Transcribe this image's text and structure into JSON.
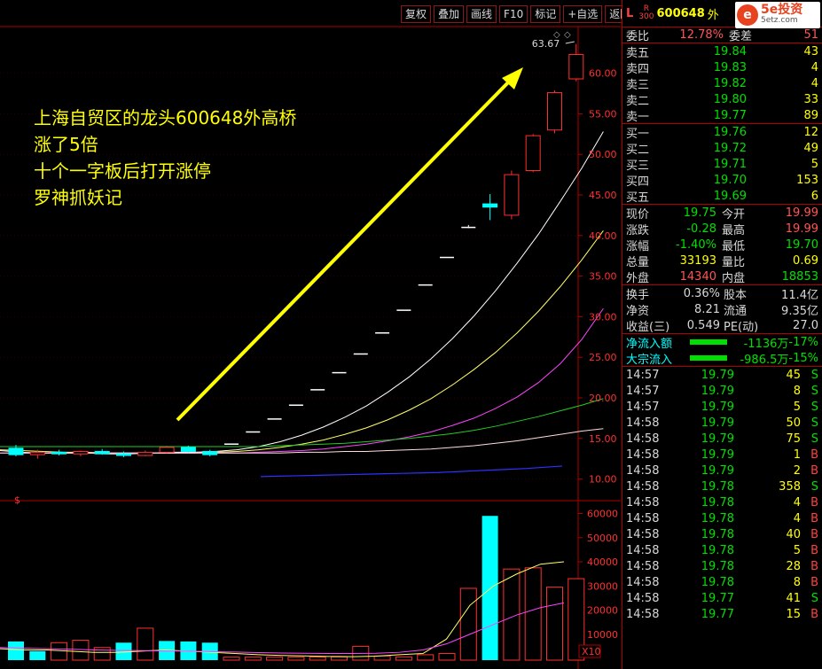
{
  "toolbar": [
    {
      "label": "复权",
      "name": "fuquan-button"
    },
    {
      "label": "叠加",
      "name": "diejia-button"
    },
    {
      "label": "画线",
      "name": "draw-line-button"
    },
    {
      "label": "F10",
      "name": "f10-button"
    },
    {
      "label": "标记",
      "name": "mark-button"
    },
    {
      "label": "+自选",
      "name": "add-watchlist-button"
    },
    {
      "label": "返回",
      "name": "back-button"
    }
  ],
  "quote": {
    "header": {
      "l": "L",
      "r": "R",
      "r_sub": "300",
      "code": "600648",
      "name": "外"
    },
    "logo": {
      "icon": "e",
      "title": "5e投资",
      "sub": "5etz.com"
    },
    "weibi": {
      "label": "委比",
      "value": "12.78%",
      "label2": "委差",
      "value2": "51"
    },
    "asks": [
      {
        "label": "卖五",
        "price": "19.84",
        "vol": "43"
      },
      {
        "label": "卖四",
        "price": "19.83",
        "vol": "4"
      },
      {
        "label": "卖三",
        "price": "19.82",
        "vol": "4"
      },
      {
        "label": "卖二",
        "price": "19.80",
        "vol": "33"
      },
      {
        "label": "卖一",
        "price": "19.77",
        "vol": "89"
      }
    ],
    "bids": [
      {
        "label": "买一",
        "price": "19.76",
        "vol": "12"
      },
      {
        "label": "买二",
        "price": "19.72",
        "vol": "49"
      },
      {
        "label": "买三",
        "price": "19.71",
        "vol": "5"
      },
      {
        "label": "买四",
        "price": "19.70",
        "vol": "153"
      },
      {
        "label": "买五",
        "price": "19.69",
        "vol": "6"
      }
    ],
    "stats1": [
      {
        "l1": "现价",
        "v1": "19.75",
        "c1": "g",
        "l2": "今开",
        "v2": "19.99",
        "c2": "r"
      },
      {
        "l1": "涨跌",
        "v1": "-0.28",
        "c1": "g",
        "l2": "最高",
        "v2": "19.99",
        "c2": "r"
      },
      {
        "l1": "涨幅",
        "v1": "-1.40%",
        "c1": "g",
        "l2": "最低",
        "v2": "19.70",
        "c2": "g"
      },
      {
        "l1": "总量",
        "v1": "33193",
        "c1": "y",
        "l2": "量比",
        "v2": "0.69",
        "c2": "y"
      },
      {
        "l1": "外盘",
        "v1": "14340",
        "c1": "r",
        "l2": "内盘",
        "v2": "18853",
        "c2": "g"
      }
    ],
    "stats2": [
      {
        "l1": "换手",
        "v1": "0.36%",
        "l2": "股本",
        "v2": "11.4亿"
      },
      {
        "l1": "净资",
        "v1": "8.21",
        "l2": "流通",
        "v2": "9.35亿"
      },
      {
        "l1": "收益(三)",
        "v1": "0.549",
        "l2": "PE(动)",
        "v2": "27.0"
      }
    ],
    "flows": [
      {
        "label": "净流入额",
        "value": "-1136万",
        "pct": "-17%"
      },
      {
        "label": "大宗流入",
        "value": "-986.5万",
        "pct": "-15%"
      }
    ],
    "ticks": [
      {
        "t": "14:57",
        "p": "19.79",
        "v": "45",
        "s": "S"
      },
      {
        "t": "14:57",
        "p": "19.79",
        "v": "8",
        "s": "S"
      },
      {
        "t": "14:57",
        "p": "19.79",
        "v": "5",
        "s": "S"
      },
      {
        "t": "14:58",
        "p": "19.79",
        "v": "50",
        "s": "S"
      },
      {
        "t": "14:58",
        "p": "19.79",
        "v": "75",
        "s": "S"
      },
      {
        "t": "14:58",
        "p": "19.79",
        "v": "1",
        "s": "B"
      },
      {
        "t": "14:58",
        "p": "19.79",
        "v": "2",
        "s": "B"
      },
      {
        "t": "14:58",
        "p": "19.78",
        "v": "358",
        "s": "S"
      },
      {
        "t": "14:58",
        "p": "19.78",
        "v": "4",
        "s": "B"
      },
      {
        "t": "14:58",
        "p": "19.78",
        "v": "4",
        "s": "B"
      },
      {
        "t": "14:58",
        "p": "19.78",
        "v": "40",
        "s": "B"
      },
      {
        "t": "14:58",
        "p": "19.78",
        "v": "5",
        "s": "B"
      },
      {
        "t": "14:58",
        "p": "19.78",
        "v": "28",
        "s": "B"
      },
      {
        "t": "14:58",
        "p": "19.78",
        "v": "8",
        "s": "B"
      },
      {
        "t": "14:58",
        "p": "19.77",
        "v": "41",
        "s": "S"
      },
      {
        "t": "14:58",
        "p": "19.77",
        "v": "15",
        "s": "B"
      }
    ]
  },
  "annotation": [
    "上海自贸区的龙头600648外高桥",
    "涨了5倍",
    "十个一字板后打开涨停",
    "罗神抓妖记"
  ],
  "colors": {
    "up": "#ff3030",
    "down": "#00ffff",
    "flat": "#ffffff",
    "grid": "#b00000",
    "arrow": "#ffff00"
  },
  "chart_data": {
    "type": "candlestick",
    "price_axis": {
      "ticks": [
        10,
        15,
        20,
        25,
        30,
        35,
        40,
        45,
        50,
        55,
        60
      ],
      "labels": [
        "10.00",
        "15.00",
        "20.00",
        "25.00",
        "30.00",
        "35.00",
        "40.00",
        "45.00",
        "50.00",
        "55.00",
        "60.00"
      ],
      "ylim": [
        7,
        67
      ]
    },
    "max_label": "63.67",
    "volume_axis": {
      "ticks": [
        10000,
        20000,
        30000,
        40000,
        50000,
        60000
      ],
      "labels": [
        "10000",
        "20000",
        "30000",
        "40000",
        "50000",
        "60000"
      ],
      "unit": "X10",
      "ylim": [
        0,
        62000
      ]
    },
    "candles": [
      {
        "o": 13.8,
        "h": 14.2,
        "l": 12.8,
        "c": 13.0
      },
      {
        "o": 13.0,
        "h": 13.6,
        "l": 12.5,
        "c": 13.3
      },
      {
        "o": 13.3,
        "h": 13.6,
        "l": 12.9,
        "c": 13.1
      },
      {
        "o": 13.1,
        "h": 13.5,
        "l": 12.8,
        "c": 13.4
      },
      {
        "o": 13.4,
        "h": 13.7,
        "l": 13.0,
        "c": 13.1
      },
      {
        "o": 13.1,
        "h": 13.4,
        "l": 12.7,
        "c": 12.9
      },
      {
        "o": 12.9,
        "h": 13.5,
        "l": 12.8,
        "c": 13.3
      },
      {
        "o": 13.3,
        "h": 14.1,
        "l": 13.2,
        "c": 13.9
      },
      {
        "o": 13.9,
        "h": 14.1,
        "l": 13.3,
        "c": 13.4
      },
      {
        "o": 13.4,
        "h": 13.6,
        "l": 12.8,
        "c": 13.0
      },
      {
        "o": 14.3,
        "h": 14.3,
        "l": 14.3,
        "c": 14.3
      },
      {
        "o": 15.8,
        "h": 15.8,
        "l": 15.8,
        "c": 15.8
      },
      {
        "o": 17.4,
        "h": 17.4,
        "l": 17.4,
        "c": 17.4
      },
      {
        "o": 19.1,
        "h": 19.1,
        "l": 19.1,
        "c": 19.1
      },
      {
        "o": 21.0,
        "h": 21.0,
        "l": 21.0,
        "c": 21.0
      },
      {
        "o": 23.1,
        "h": 23.1,
        "l": 23.1,
        "c": 23.1
      },
      {
        "o": 25.4,
        "h": 25.4,
        "l": 25.4,
        "c": 25.4
      },
      {
        "o": 28.0,
        "h": 28.0,
        "l": 28.0,
        "c": 28.0
      },
      {
        "o": 30.8,
        "h": 30.8,
        "l": 30.8,
        "c": 30.8
      },
      {
        "o": 33.9,
        "h": 33.9,
        "l": 33.9,
        "c": 33.9
      },
      {
        "o": 37.3,
        "h": 37.3,
        "l": 37.3,
        "c": 37.3
      },
      {
        "o": 41.0,
        "h": 41.3,
        "l": 40.9,
        "c": 41.0
      },
      {
        "o": 43.9,
        "h": 45.1,
        "l": 41.9,
        "c": 43.5
      },
      {
        "o": 42.5,
        "h": 48.0,
        "l": 42.0,
        "c": 47.5
      },
      {
        "o": 48.0,
        "h": 52.5,
        "l": 47.8,
        "c": 52.3
      },
      {
        "o": 53.0,
        "h": 57.9,
        "l": 52.6,
        "c": 57.6
      },
      {
        "o": 59.3,
        "h": 63.6,
        "l": 59.0,
        "c": 62.3
      }
    ],
    "volumes": [
      {
        "v": 7000,
        "d": "down"
      },
      {
        "v": 3000,
        "d": "down"
      },
      {
        "v": 6500,
        "d": "up"
      },
      {
        "v": 7500,
        "d": "up"
      },
      {
        "v": 4500,
        "d": "up"
      },
      {
        "v": 6500,
        "d": "down"
      },
      {
        "v": 12500,
        "d": "up"
      },
      {
        "v": 7200,
        "d": "down"
      },
      {
        "v": 7000,
        "d": "down"
      },
      {
        "v": 6500,
        "d": "down"
      },
      {
        "v": 500,
        "d": "flat"
      },
      {
        "v": 500,
        "d": "flat"
      },
      {
        "v": 500,
        "d": "flat"
      },
      {
        "v": 500,
        "d": "flat"
      },
      {
        "v": 500,
        "d": "flat"
      },
      {
        "v": 600,
        "d": "flat"
      },
      {
        "v": 5000,
        "d": "up"
      },
      {
        "v": 1000,
        "d": "flat"
      },
      {
        "v": 600,
        "d": "flat"
      },
      {
        "v": 1500,
        "d": "flat"
      },
      {
        "v": 2000,
        "d": "flat"
      },
      {
        "v": 29000,
        "d": "up"
      },
      {
        "v": 59000,
        "d": "down"
      },
      {
        "v": 37000,
        "d": "up"
      },
      {
        "v": 37500,
        "d": "up"
      },
      {
        "v": 29500,
        "d": "up"
      },
      {
        "v": 33000,
        "d": "up"
      }
    ],
    "ma_lines": [
      {
        "color": "#ffffff",
        "values": [
          13.5,
          13.3,
          13.2,
          13.2,
          13.2,
          13.1,
          13.1,
          13.2,
          13.3,
          13.3,
          13.4,
          13.6,
          14.0,
          14.6,
          15.4,
          16.4,
          17.6,
          19.0,
          20.7,
          22.6,
          24.8,
          27.3,
          30.1,
          33.2,
          36.6,
          40.2,
          44.2,
          48.3,
          52.8
        ]
      },
      {
        "color": "#ffff66",
        "values": [
          13.6,
          13.5,
          13.4,
          13.3,
          13.3,
          13.2,
          13.2,
          13.2,
          13.2,
          13.2,
          13.3,
          13.4,
          13.6,
          13.9,
          14.3,
          14.8,
          15.5,
          16.3,
          17.3,
          18.5,
          19.9,
          21.6,
          23.5,
          25.6,
          28.0,
          30.7,
          33.7,
          37.0,
          40.6
        ]
      },
      {
        "color": "#ff44ff",
        "values": [
          13.2,
          13.2,
          13.2,
          13.2,
          13.2,
          13.2,
          13.2,
          13.2,
          13.2,
          13.2,
          13.2,
          13.2,
          13.3,
          13.4,
          13.5,
          13.7,
          14.0,
          14.3,
          14.7,
          15.2,
          15.8,
          16.6,
          17.5,
          18.7,
          20.1,
          21.9,
          24.2,
          27.2,
          31.0
        ]
      },
      {
        "color": "#22cc22",
        "values": [
          14.0,
          14.0,
          14.0,
          14.0,
          14.0,
          14.0,
          14.0,
          14.0,
          14.0,
          14.0,
          14.0,
          14.0,
          14.0,
          14.1,
          14.2,
          14.3,
          14.4,
          14.6,
          14.8,
          15.0,
          15.3,
          15.6,
          16.0,
          16.5,
          17.1,
          17.7,
          18.4,
          19.1,
          19.9
        ]
      },
      {
        "color": "#ffdddd",
        "values": [
          13.2,
          13.2,
          13.2,
          13.2,
          13.2,
          13.2,
          13.2,
          13.2,
          13.2,
          13.2,
          13.2,
          13.2,
          13.2,
          13.2,
          13.3,
          13.3,
          13.4,
          13.4,
          13.5,
          13.6,
          13.7,
          13.9,
          14.1,
          14.4,
          14.7,
          15.1,
          15.5,
          15.9,
          16.2
        ]
      }
    ],
    "ma_blue": {
      "color": "#3030ff",
      "values": [
        10.3,
        10.35,
        10.4,
        10.45,
        10.5,
        10.55,
        10.6,
        10.65,
        10.7,
        10.75,
        10.8,
        10.9,
        11.0,
        11.1,
        11.2,
        11.3,
        11.45,
        11.6
      ]
    },
    "vol_ma": [
      {
        "color": "#ffff66",
        "values": [
          4000,
          3500,
          3500,
          3000,
          2500,
          2500,
          3000,
          3500,
          3000,
          2500,
          2000,
          1500,
          1200,
          1000,
          800,
          700,
          900,
          1500,
          2000,
          8000,
          22000,
          30000,
          35000,
          39000,
          40000
        ]
      },
      {
        "color": "#ff44ff",
        "values": [
          4500,
          4200,
          4000,
          3800,
          3500,
          3300,
          3200,
          3100,
          3000,
          2800,
          2600,
          2400,
          2200,
          2100,
          2000,
          2000,
          2100,
          2500,
          3500,
          6000,
          10000,
          14000,
          18000,
          21000,
          23000
        ]
      }
    ]
  }
}
